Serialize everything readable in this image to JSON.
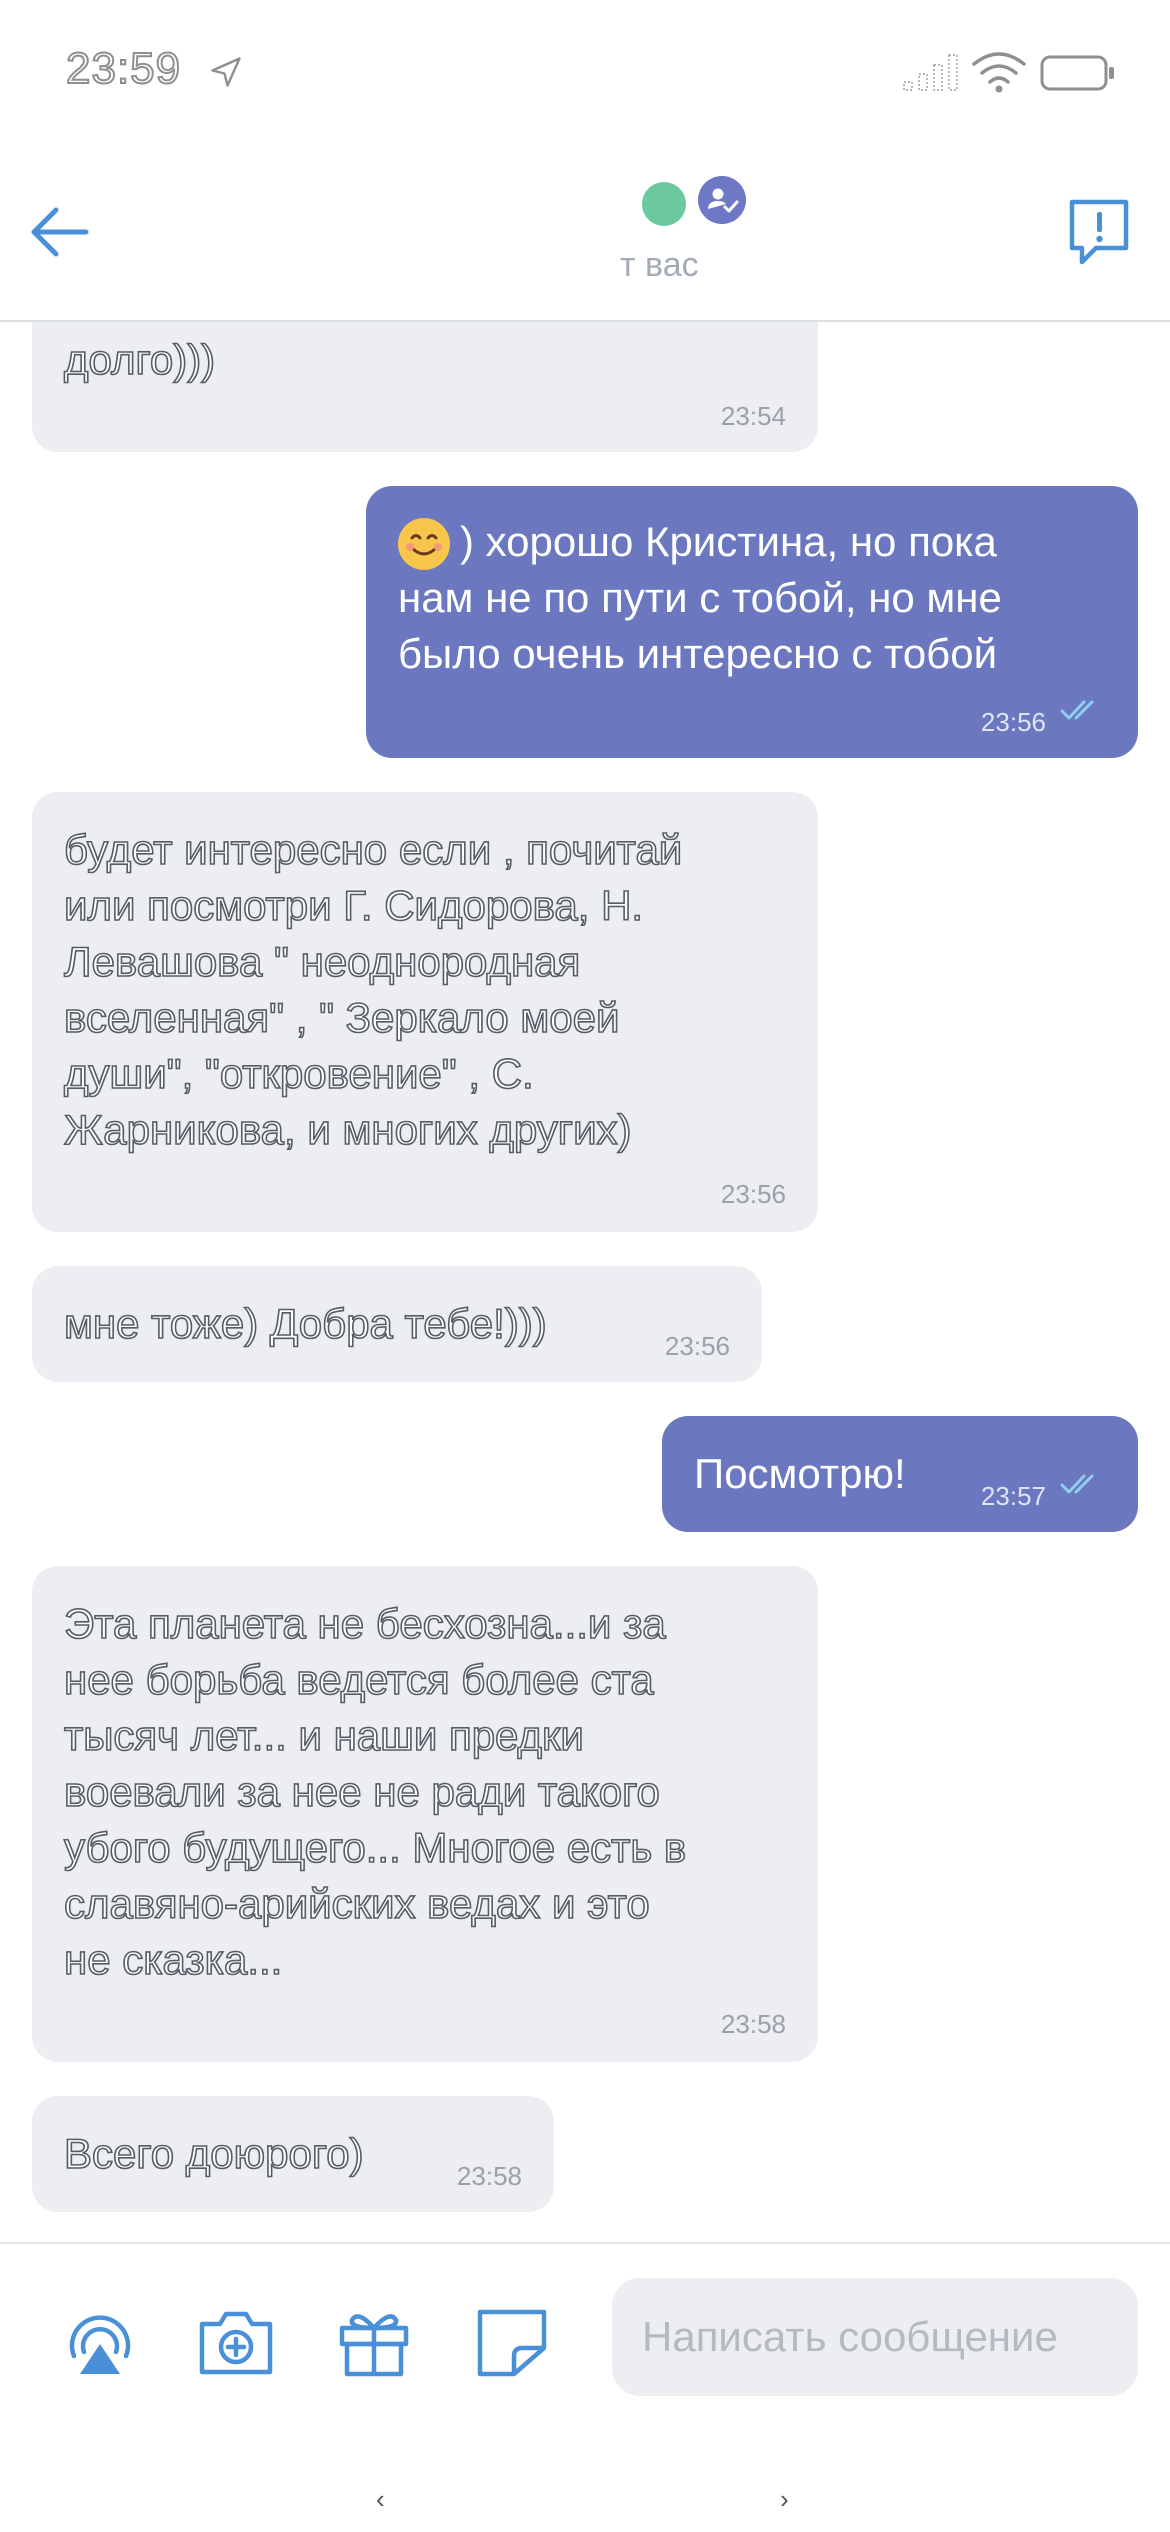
{
  "status_bar": {
    "time": "23:59"
  },
  "header": {
    "subtitle": "т вас"
  },
  "messages": [
    {
      "text": "долго)))",
      "time": "23:54"
    },
    {
      "text": ") хорошо Кристина, но пока\nнам не по пути с тобой, но мне\nбыло очень интересно с тобой",
      "time": "23:56"
    },
    {
      "text": "будет интересно если , почитай\nили посмотри Г. Сидорова, Н.\nЛевашова \" неоднородная\nвселенная\" , \" Зеркало моей\nдуши\", \"откровение\" , С.\nЖарникова, и многих других)",
      "time": "23:56"
    },
    {
      "text": "мне тоже) Добра тебе!)))",
      "time": "23:56"
    },
    {
      "text": "Посмотрю!",
      "time": "23:57"
    },
    {
      "text": "Эта планета не бесхозна...и за\nнее борьба ведется более ста\nтысяч лет... и наши предки\nвоевали за нее не ради такого\nубого будущего... Многое есть в\nславяно-арийских ведах и это\nне сказка...",
      "time": "23:58"
    },
    {
      "text": "Всего доюрого)",
      "time": "23:58"
    }
  ],
  "composer": {
    "placeholder": "Написать сообщение"
  },
  "icons": {
    "back": "arrow-left-icon",
    "report": "exclamation-bubble-icon",
    "tools": [
      "podcast-icon",
      "camera-plus-icon",
      "gift-icon",
      "sticker-icon"
    ]
  },
  "colors": {
    "accent": "#4a90d9",
    "outgoing_bubble": "#6b78bf",
    "incoming_bubble": "#edeef2",
    "online": "#6cc89e"
  }
}
